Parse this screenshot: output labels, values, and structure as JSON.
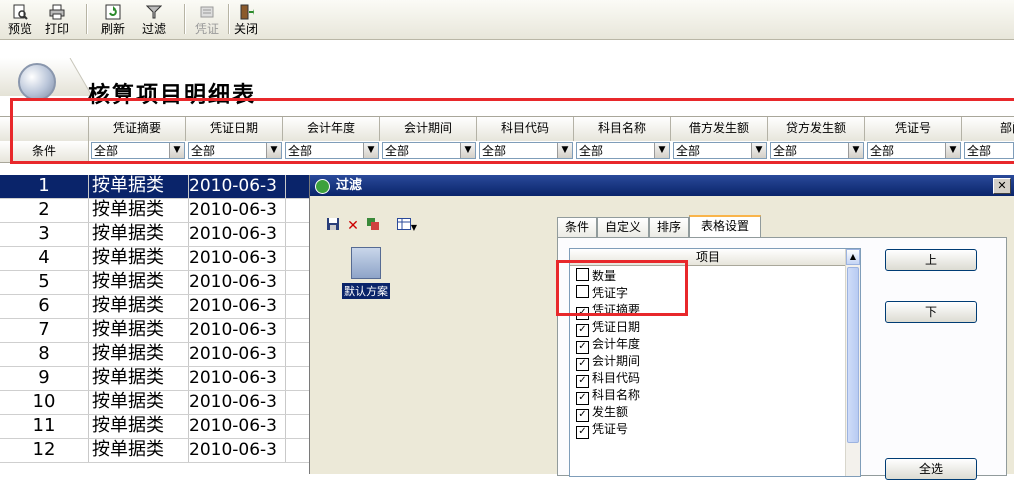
{
  "toolbar": {
    "buttons": [
      {
        "label": "预览",
        "icon": "preview-icon",
        "enabled": true
      },
      {
        "label": "打印",
        "icon": "printer-icon",
        "enabled": true
      },
      {
        "label": "刷新",
        "icon": "refresh-icon",
        "enabled": true
      },
      {
        "label": "过滤",
        "icon": "filter-icon",
        "enabled": true
      },
      {
        "label": "凭证",
        "icon": "voucher-icon",
        "enabled": false
      },
      {
        "label": "关闭",
        "icon": "exit-door-icon",
        "enabled": true
      }
    ]
  },
  "report": {
    "title": "核算项目明细表"
  },
  "grid": {
    "condition_label": "条件",
    "columns": [
      "凭证摘要",
      "凭证日期",
      "会计年度",
      "会计期间",
      "科目代码",
      "科目名称",
      "借方发生额",
      "贷方发生额",
      "凭证号",
      "部门"
    ],
    "filter_value": "全部",
    "rows": [
      {
        "no": "1",
        "summary": "按单据类",
        "date": "2010-06-3"
      },
      {
        "no": "2",
        "summary": "按单据类",
        "date": "2010-06-3"
      },
      {
        "no": "3",
        "summary": "按单据类",
        "date": "2010-06-3"
      },
      {
        "no": "4",
        "summary": "按单据类",
        "date": "2010-06-3"
      },
      {
        "no": "5",
        "summary": "按单据类",
        "date": "2010-06-3"
      },
      {
        "no": "6",
        "summary": "按单据类",
        "date": "2010-06-3"
      },
      {
        "no": "7",
        "summary": "按单据类",
        "date": "2010-06-3"
      },
      {
        "no": "8",
        "summary": "按单据类",
        "date": "2010-06-3"
      },
      {
        "no": "9",
        "summary": "按单据类",
        "date": "2010-06-3"
      },
      {
        "no": "10",
        "summary": "按单据类",
        "date": "2010-06-3"
      },
      {
        "no": "11",
        "summary": "按单据类",
        "date": "2010-06-3"
      },
      {
        "no": "12",
        "summary": "按单据类",
        "date": "2010-06-3"
      }
    ]
  },
  "dialog": {
    "title": "过滤",
    "close_glyph": "✕",
    "scheme_label": "默认方案",
    "tabs": [
      "条件",
      "自定义",
      "排序",
      "表格设置"
    ],
    "active_tab": "表格设置",
    "list_header": "项目",
    "items": [
      {
        "label": "数量",
        "checked": false
      },
      {
        "label": "凭证字",
        "checked": false
      },
      {
        "label": "凭证摘要",
        "checked": true
      },
      {
        "label": "凭证日期",
        "checked": true
      },
      {
        "label": "会计年度",
        "checked": true
      },
      {
        "label": "会计期间",
        "checked": true
      },
      {
        "label": "科目代码",
        "checked": true
      },
      {
        "label": "科目名称",
        "checked": true
      },
      {
        "label": "发生额",
        "checked": true
      },
      {
        "label": "凭证号",
        "checked": true
      }
    ],
    "buttons": {
      "up": "上",
      "down": "下",
      "select_all": "全选"
    }
  },
  "colors": {
    "selection": "#0a246a",
    "highlight_box": "#e8282b"
  }
}
